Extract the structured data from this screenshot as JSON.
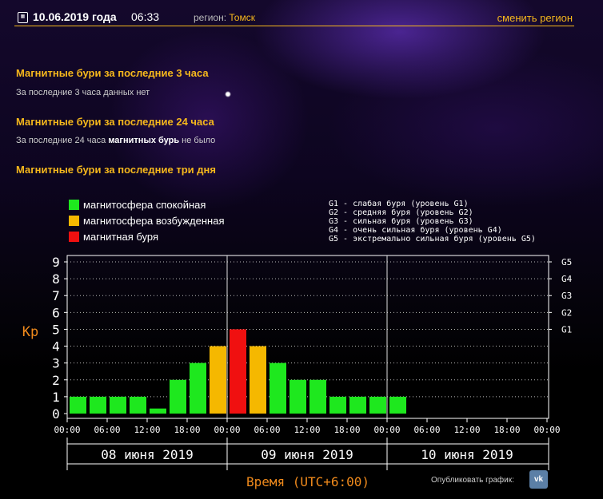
{
  "header": {
    "date": "10.06.2019 года",
    "time": "06:33",
    "region_label": "регион:",
    "region_name": "Томск",
    "change_region": "сменить регион",
    "calendar_icon": "calendar-icon"
  },
  "sections": [
    {
      "title": "Магнитные бури за последние 3 часа",
      "note": "За последние 3 часа данных нет"
    },
    {
      "title": "Магнитные бури за последние 24 часа",
      "note_pre": "За последние 24 часа ",
      "note_bold": "магнитных бурь",
      "note_post": " не было"
    },
    {
      "title": "Магнитные бури за последние три дня"
    }
  ],
  "legend": {
    "quiet": "магнитосфера спокойная",
    "excited": "магнитосфера возбужденная",
    "storm": "магнитная буря"
  },
  "storm_levels": [
    "G1 - слабая буря (уровень G1)",
    "G2 - средняя буря (уровень G2)",
    "G3 - сильная буря (уровень G3)",
    "G4 - очень сильная буря (уровень G4)",
    "G5 - экстремально сильная буря (уровень G5)"
  ],
  "colors": {
    "quiet": "#1ee81e",
    "excited": "#f5b800",
    "storm": "#f01010",
    "accent": "#f6b81c",
    "axis_title": "#f08a1c"
  },
  "chart_data": {
    "type": "bar",
    "ylabel": "Kp",
    "xlabel": "Время (UTC+6:00)",
    "ylim": [
      0,
      9
    ],
    "y_ticks": [
      "0",
      "1",
      "2",
      "3",
      "4",
      "5",
      "6",
      "7",
      "8",
      "9"
    ],
    "g_ticks": [
      {
        "label": "G1",
        "value": 5
      },
      {
        "label": "G2",
        "value": 6
      },
      {
        "label": "G3",
        "value": 7
      },
      {
        "label": "G4",
        "value": 8
      },
      {
        "label": "G5",
        "value": 9
      }
    ],
    "x_tick_labels": [
      "00:00",
      "06:00",
      "12:00",
      "18:00",
      "00:00",
      "06:00",
      "12:00",
      "18:00",
      "00:00",
      "06:00",
      "12:00",
      "18:00",
      "00:00"
    ],
    "days": [
      "08 июня 2019",
      "09 июня 2019",
      "10 июня 2019"
    ],
    "values": [
      1,
      1,
      1,
      1,
      0.3,
      2,
      3,
      4,
      5,
      4,
      3,
      2,
      2,
      1,
      1,
      1,
      1
    ],
    "levels": [
      "quiet",
      "quiet",
      "quiet",
      "quiet",
      "quiet",
      "quiet",
      "quiet",
      "excited",
      "storm",
      "excited",
      "quiet",
      "quiet",
      "quiet",
      "quiet",
      "quiet",
      "quiet",
      "quiet"
    ],
    "grid": true
  },
  "share": {
    "label": "Опубликовать график:",
    "vk": "vk"
  }
}
